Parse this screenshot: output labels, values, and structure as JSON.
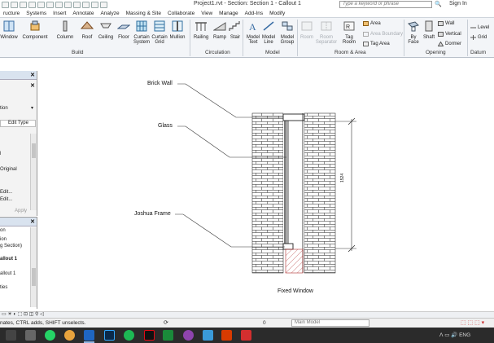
{
  "titlebar": {
    "title": "Project1.rvt - Section: Section 1 - Callout 1",
    "search_placeholder": "Type a keyword or phrase",
    "sign_in": "Sign In"
  },
  "tabs": [
    "ructure",
    "Systems",
    "Insert",
    "Annotate",
    "Analyze",
    "Massing & Site",
    "Collaborate",
    "View",
    "Manage",
    "Add-Ins",
    "Modify"
  ],
  "ribbon": {
    "build": {
      "title": "Build",
      "items": [
        "Window",
        "Component",
        "Column",
        "Roof",
        "Ceiling",
        "Floor",
        "Curtain System",
        "Curtain Grid",
        "Mullion"
      ]
    },
    "circulation": {
      "title": "Circulation",
      "items": [
        "Railing",
        "Ramp",
        "Stair"
      ]
    },
    "model": {
      "title": "Model",
      "items": [
        "Model Text",
        "Model Line",
        "Model Group"
      ]
    },
    "room_area": {
      "title": "Room & Area",
      "items": [
        "Room",
        "Room Separator",
        "Tag Room"
      ],
      "small": [
        "Area",
        "Area Boundary",
        "Tag Area"
      ]
    },
    "opening": {
      "title": "Opening",
      "items": [
        "By Face",
        "Shaft"
      ],
      "small": [
        "Wall",
        "Vertical",
        "Dormer"
      ]
    },
    "datum": {
      "title": "Datum",
      "small": [
        "Level",
        "Grid"
      ]
    }
  },
  "properties": {
    "rows": [
      "tion",
      "Edit Type",
      "l",
      "Original",
      "Edit...",
      "Edit...",
      "Apply"
    ]
  },
  "browser": {
    "rows": [
      "on",
      "ion",
      "g Section)",
      "allout 1",
      "allout 1",
      "ties"
    ]
  },
  "drawing": {
    "labels": {
      "brick_wall": "Brick Wall",
      "glass": "Glass",
      "frame": "Joshua Frame",
      "dimension": "1524",
      "caption": "Fixed Window"
    }
  },
  "statusbar": {
    "text": "nates, CTRL adds, SHIFT unselects.",
    "filter_count": "0",
    "workset": "Main Model"
  },
  "colors": {
    "ribbon_bg": "#f3f5f8",
    "panel_header": "#d9e3ef",
    "taskbar": "#2b2b2b"
  }
}
